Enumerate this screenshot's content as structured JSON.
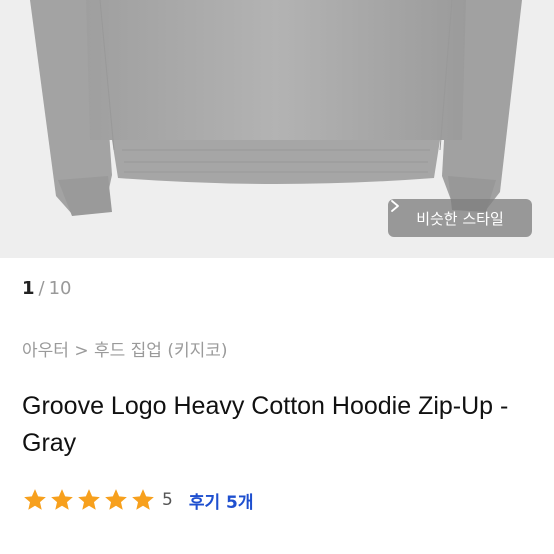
{
  "gallery": {
    "similar_styles_label": "비슷한 스타일",
    "current_index": "1",
    "separator": "/",
    "total": "10"
  },
  "product": {
    "breadcrumb": "아우터 > 후드 집업 (키지코)",
    "title": "Groove Logo Heavy Cotton Hoodie Zip-Up - Gray"
  },
  "rating": {
    "stars": 5,
    "star_color": "#f7a01d",
    "score": "5",
    "review_label": "후기 5개"
  },
  "colors": {
    "review_link": "#1e4fcf",
    "image_background": "#eeeeee"
  }
}
